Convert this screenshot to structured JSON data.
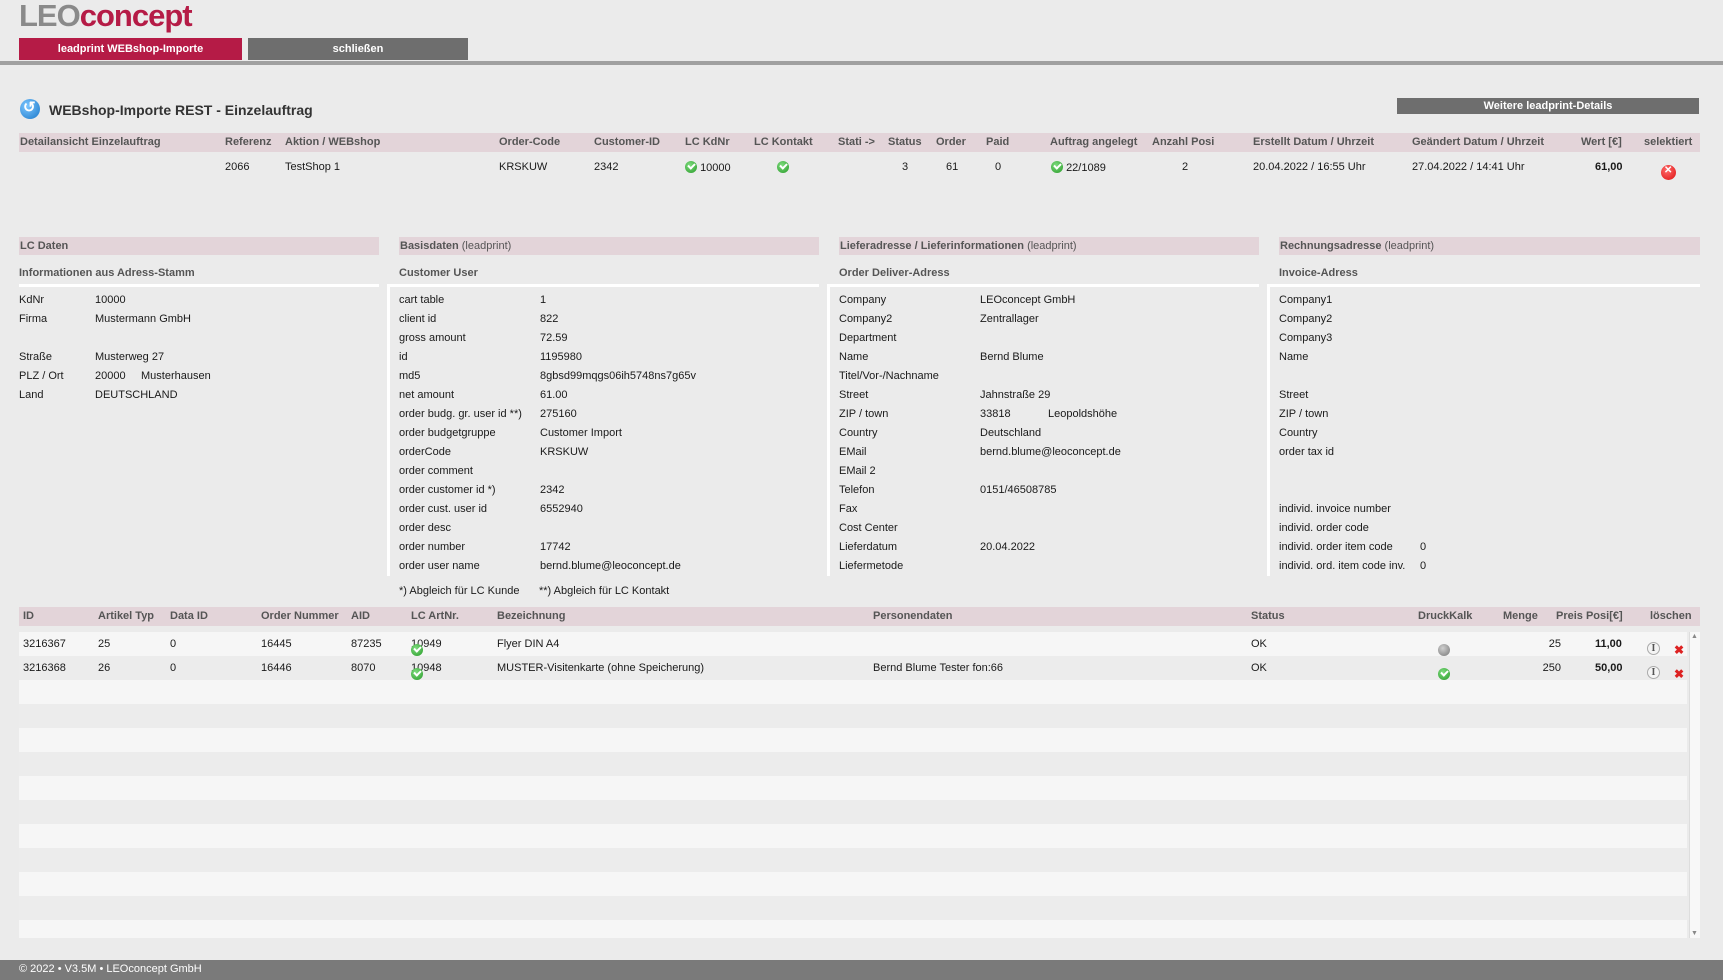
{
  "logo": {
    "part1": "LEO",
    "part2": "concept"
  },
  "top_tabs": {
    "active": "leadprint WEBshop-Importe",
    "close": "schließen"
  },
  "page_title": "WEBshop-Importe REST - Einzelauftrag",
  "details_button": "Weitere leadprint-Details",
  "order_header": [
    "Detailansicht Einzelauftrag",
    "Referenz",
    "Aktion / WEBshop",
    "Order-Code",
    "Customer-ID",
    "LC KdNr",
    "LC Kontakt",
    "Stati ->",
    "Status",
    "Order",
    "Paid",
    "Auftrag angelegt",
    "Anzahl Posi",
    "Erstellt Datum / Uhrzeit",
    "Geändert Datum / Uhrzeit",
    "Wert [€]",
    "selektiert"
  ],
  "order_row": {
    "referenz": "2066",
    "aktion": "TestShop 1",
    "order_code": "KRSKUW",
    "customer_id": "2342",
    "lc_kdnr": "10000",
    "status": "3",
    "order": "61",
    "paid": "0",
    "auftrag": "22/1089",
    "anzahl_posi": "2",
    "erstellt": "20.04.2022 / 16:55 Uhr",
    "geaendert": "27.04.2022 / 14:41 Uhr",
    "wert": "61,00"
  },
  "lc_daten": {
    "title": "LC Daten",
    "sub": "Informationen aus Adress-Stamm",
    "kdnr_label": "KdNr",
    "kdnr": "10000",
    "firma_label": "Firma",
    "firma": "Mustermann GmbH",
    "strasse_label": "Straße",
    "strasse": "Musterweg 27",
    "plz_label": "PLZ / Ort",
    "plz": "20000",
    "ort": "Musterhausen",
    "land_label": "Land",
    "land": "DEUTSCHLAND"
  },
  "basisdaten": {
    "title": "Basisdaten",
    "title_sub": "(leadprint)",
    "sub": "Customer User",
    "rows": [
      {
        "k": "cart table",
        "v": "1"
      },
      {
        "k": "client id",
        "v": "822"
      },
      {
        "k": "gross amount",
        "v": "72.59"
      },
      {
        "k": "id",
        "v": "1195980"
      },
      {
        "k": "md5",
        "v": "8gbsd99mqgs06ih5748ns7g65v"
      },
      {
        "k": "net amount",
        "v": "61.00"
      },
      {
        "k": "order budg. gr. user id **)",
        "v": "275160"
      },
      {
        "k": "order budgetgruppe",
        "v": "Customer Import"
      },
      {
        "k": "orderCode",
        "v": "KRSKUW"
      },
      {
        "k": "order comment",
        "v": ""
      },
      {
        "k": "order customer id *)",
        "v": "2342"
      },
      {
        "k": "order cust. user id",
        "v": "6552940"
      },
      {
        "k": "order desc",
        "v": ""
      },
      {
        "k": "order number",
        "v": "17742"
      },
      {
        "k": "order user name",
        "v": "bernd.blume@leoconcept.de"
      }
    ],
    "note1": "*) Abgleich für LC Kunde",
    "note2": "**) Abgleich für LC Kontakt"
  },
  "lieferadresse": {
    "title": "Lieferadresse / Lieferinformationen",
    "title_sub": "(leadprint)",
    "sub": "Order Deliver-Adress",
    "rows": [
      {
        "k": "Company",
        "v": "LEOconcept GmbH"
      },
      {
        "k": "Company2",
        "v": "Zentrallager"
      },
      {
        "k": "Department",
        "v": ""
      },
      {
        "k": "Name",
        "v": "Bernd Blume"
      },
      {
        "k": "Titel/Vor-/Nachname",
        "v": ""
      },
      {
        "k": "Street",
        "v": "Jahnstraße 29"
      },
      {
        "k": "ZIP / town",
        "v": "33818",
        "v2": "Leopoldshöhe"
      },
      {
        "k": "Country",
        "v": "Deutschland"
      },
      {
        "k": "EMail",
        "v": "bernd.blume@leoconcept.de"
      },
      {
        "k": "EMail 2",
        "v": ""
      },
      {
        "k": "Telefon",
        "v": "0151/46508785"
      },
      {
        "k": "Fax",
        "v": ""
      },
      {
        "k": "Cost Center",
        "v": ""
      },
      {
        "k": "Lieferdatum",
        "v": "20.04.2022"
      },
      {
        "k": "Liefermetode",
        "v": ""
      }
    ]
  },
  "rechnungsadresse": {
    "title": "Rechnungsadresse",
    "title_sub": "(leadprint)",
    "sub": "Invoice-Adress",
    "rows": [
      {
        "k": "Company1",
        "v": ""
      },
      {
        "k": "Company2",
        "v": ""
      },
      {
        "k": "Company3",
        "v": ""
      },
      {
        "k": "Name",
        "v": ""
      },
      {
        "k": "",
        "v": ""
      },
      {
        "k": "Street",
        "v": ""
      },
      {
        "k": "ZIP / town",
        "v": ""
      },
      {
        "k": "Country",
        "v": ""
      },
      {
        "k": "order tax id",
        "v": ""
      },
      {
        "k": "",
        "v": ""
      },
      {
        "k": "",
        "v": ""
      },
      {
        "k": "individ. invoice number",
        "v": ""
      },
      {
        "k": "individ. order code",
        "v": ""
      },
      {
        "k": "individ. order item code",
        "v": "0"
      },
      {
        "k": "individ. ord. item code inv.",
        "v": "0"
      }
    ]
  },
  "items_header": [
    "ID",
    "Artikel Typ",
    "Data ID",
    "Order Nummer",
    "AID",
    "LC ArtNr.",
    "Bezeichnung",
    "Personendaten",
    "Status",
    "DruckKalk",
    "Menge",
    "Preis Posi[€]",
    "löschen"
  ],
  "items": [
    {
      "id": "3216367",
      "typ": "25",
      "data_id": "0",
      "order_nr": "16445",
      "aid": "87235",
      "artnr": "10949",
      "bez": "Flyer DIN A4",
      "personen": "",
      "status": "OK",
      "menge": "25",
      "preis": "11,00"
    },
    {
      "id": "3216368",
      "typ": "26",
      "data_id": "0",
      "order_nr": "16446",
      "aid": "8070",
      "artnr": "10948",
      "bez": "MUSTER-Visitenkarte (ohne Speicherung)",
      "personen": "Bernd Blume Tester fon:66",
      "status": "OK",
      "menge": "250",
      "preis": "50,00"
    }
  ],
  "footer": "© 2022 • V3.5M • LEOconcept GmbH"
}
